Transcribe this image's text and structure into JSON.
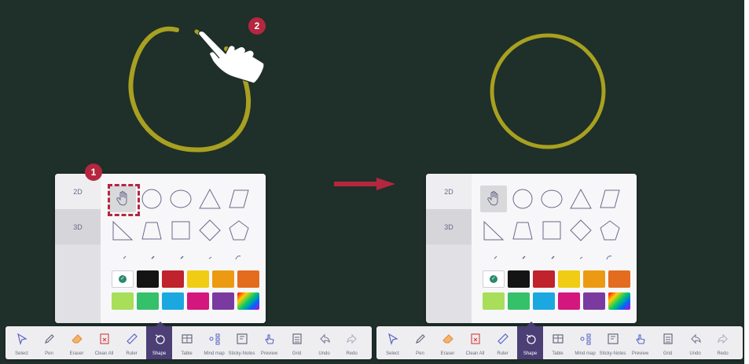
{
  "steps": {
    "one": "1",
    "two": "2"
  },
  "panel": {
    "tabs": [
      "2D",
      "3D"
    ],
    "shapes_row1": [
      "hand-select",
      "circle",
      "ellipse",
      "triangle",
      "parallelogram"
    ],
    "shapes_row2": [
      "right-triangle",
      "trapezoid",
      "square",
      "diamond",
      "pentagon"
    ],
    "colors_row1": [
      "#ffffff",
      "#141414",
      "#c0232b",
      "#f0cc12",
      "#ec9a12",
      "#e36c1e"
    ],
    "colors_row2": [
      "#a8de5a",
      "#35c06a",
      "#1ba8e0",
      "#d4177e",
      "#7a3aa0",
      "palette"
    ]
  },
  "toolbar": {
    "select": "Select",
    "pen": "Pen",
    "eraser": "Eraser",
    "clean_all": "Clean All",
    "ruler": "Ruler",
    "shape": "Shape",
    "table": "Table",
    "mind_map": "Mind map",
    "sticky_notes": "Sticky-Notes",
    "preview": "Preview",
    "grid": "Grid",
    "undo": "Undo",
    "redo": "Redo"
  },
  "colors": {
    "board": "#1f2f29",
    "stroke": "#a8a020",
    "accent": "#4b3f75",
    "badge": "#b5263f"
  }
}
